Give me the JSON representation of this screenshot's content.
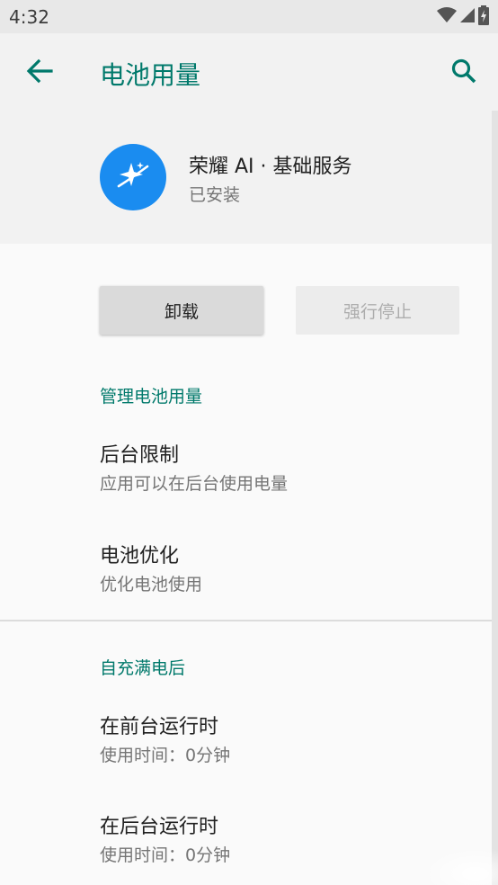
{
  "status_bar": {
    "time": "4:32",
    "icons": [
      "wifi-icon",
      "cell-signal-icon",
      "battery-icon"
    ]
  },
  "app_bar": {
    "title": "电池用量",
    "back_icon": "arrow-back-icon",
    "search_icon": "search-icon"
  },
  "app_header": {
    "icon": "sparkle-orbit-icon",
    "icon_color": "#1a8cf0",
    "name": "荣耀 AI · 基础服务",
    "status": "已安装"
  },
  "buttons": {
    "uninstall": "卸载",
    "force_stop": "强行停止"
  },
  "sections": {
    "manage": {
      "header": "管理电池用量",
      "items": [
        {
          "title": "后台限制",
          "summary": "应用可以在后台使用电量"
        },
        {
          "title": "电池优化",
          "summary": "优化电池使用"
        }
      ]
    },
    "since_full_charge": {
      "header": "自充满电后",
      "items": [
        {
          "title": "在前台运行时",
          "summary": "使用时间：0分钟"
        },
        {
          "title": "在后台运行时",
          "summary": "使用时间：0分钟"
        }
      ]
    }
  },
  "colors": {
    "accent": "#00796b",
    "app_bar_bg": "#f2f2f2",
    "status_bar_bg": "#e8e8e8"
  }
}
